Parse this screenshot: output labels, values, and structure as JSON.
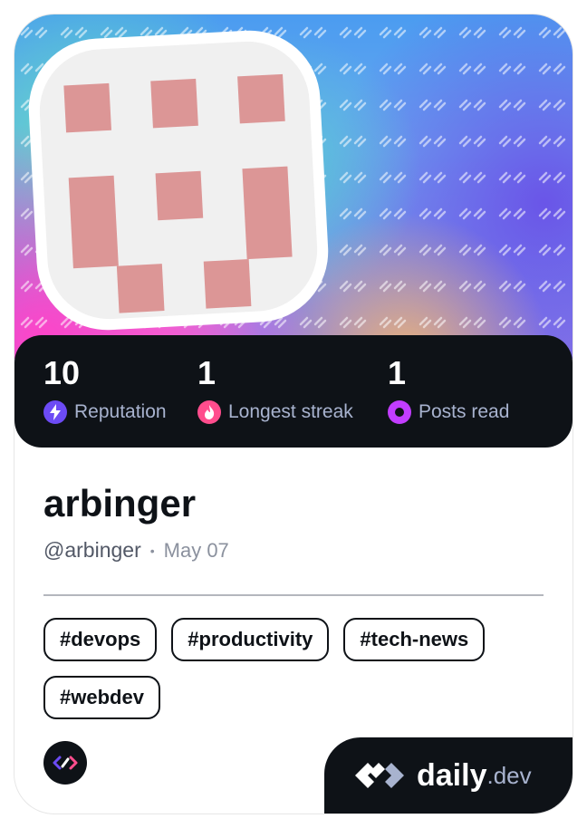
{
  "profile": {
    "name": "arbinger",
    "handle": "@arbinger",
    "joined": "May 07"
  },
  "stats": [
    {
      "value": "10",
      "label": "Reputation",
      "icon": "lightning-icon",
      "color": "#6c4bf5"
    },
    {
      "value": "1",
      "label": "Longest streak",
      "icon": "flame-icon",
      "color": "#ff4d8d"
    },
    {
      "value": "1",
      "label": "Posts read",
      "icon": "eye-icon",
      "color": "#c23dff"
    }
  ],
  "tags": [
    "#devops",
    "#productivity",
    "#tech-news",
    "#webdev"
  ],
  "brand": {
    "name": "daily",
    "suffix": ".dev"
  },
  "colors": {
    "dark": "#0e1217",
    "avatar_bg": "#f0f0f0",
    "avatar_px": "#dc9696",
    "muted": "#a8b3cf"
  }
}
